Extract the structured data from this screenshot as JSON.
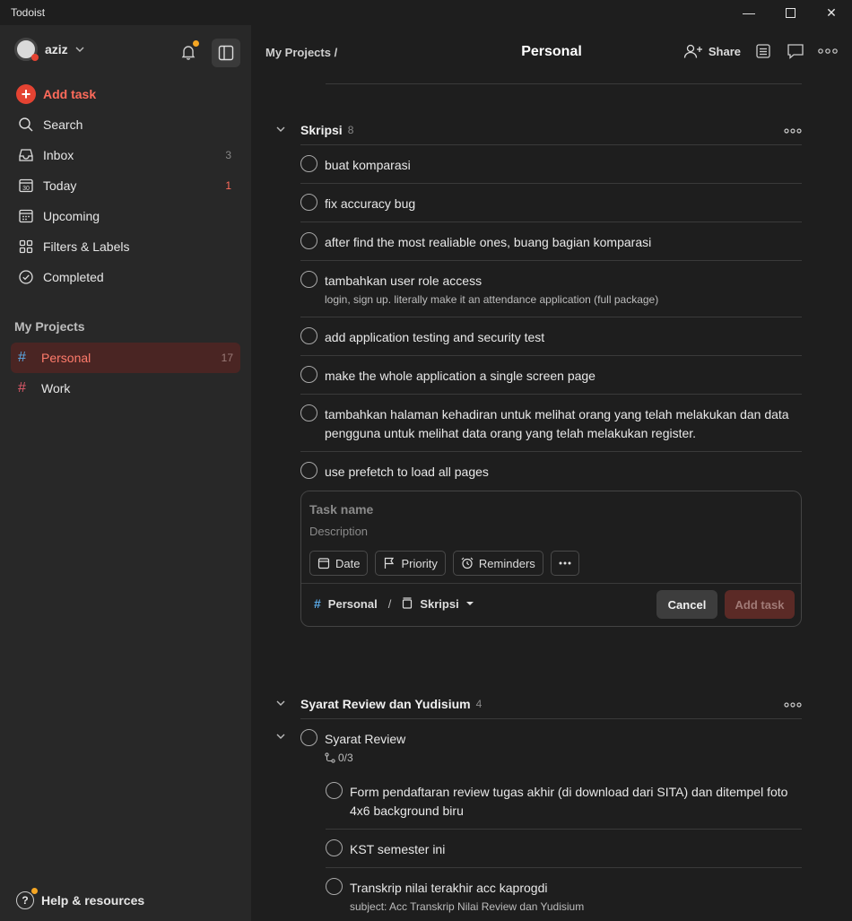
{
  "window": {
    "title": "Todoist",
    "minimize": "—",
    "maximize": "☐",
    "close": "✕"
  },
  "sidebar": {
    "user": "aziz",
    "add_task": "Add task",
    "nav": [
      {
        "label": "Search",
        "count": ""
      },
      {
        "label": "Inbox",
        "count": "3"
      },
      {
        "label": "Today",
        "count": "1"
      },
      {
        "label": "Upcoming",
        "count": ""
      },
      {
        "label": "Filters & Labels",
        "count": ""
      },
      {
        "label": "Completed",
        "count": ""
      }
    ],
    "today_day": "30",
    "projects_label": "My Projects",
    "projects": [
      {
        "label": "Personal",
        "count": "17"
      },
      {
        "label": "Work",
        "count": ""
      }
    ],
    "help": "Help & resources"
  },
  "header": {
    "breadcrumb": "My Projects /",
    "title": "Personal",
    "share": "Share"
  },
  "sections": [
    {
      "title": "Skripsi",
      "count": "8",
      "tasks": [
        {
          "name": "buat komparasi"
        },
        {
          "name": "fix accuracy bug"
        },
        {
          "name": "after find the most realiable ones, buang bagian komparasi"
        },
        {
          "name": "tambahkan user role access",
          "desc": "login, sign up. literally make it an attendance application (full package)"
        },
        {
          "name": "add application testing and security test"
        },
        {
          "name": "make the whole application a single screen page"
        },
        {
          "name": "tambahkan halaman kehadiran untuk melihat orang yang telah melakukan dan data pengguna untuk melihat data orang yang telah melakukan register."
        },
        {
          "name": "use prefetch to load all pages"
        }
      ]
    },
    {
      "title": "Syarat Review dan Yudisium",
      "count": "4",
      "tasks": [
        {
          "name": "Syarat Review",
          "subtasks": "0/3"
        },
        {
          "name": "Form pendaftaran review tugas akhir (di download dari SITA) dan ditempel foto 4x6 background biru"
        },
        {
          "name": "KST semester ini"
        },
        {
          "name": "Transkrip nilai terakhir acc kaprogdi",
          "desc": "subject: Acc Transkrip Nilai Review dan Yudisium"
        }
      ]
    }
  ],
  "editor": {
    "name_placeholder": "Task name",
    "desc_placeholder": "Description",
    "chips": [
      "Date",
      "Priority",
      "Reminders"
    ],
    "project": "Personal",
    "separator": "/",
    "section": "Skripsi",
    "cancel": "Cancel",
    "submit": "Add task"
  },
  "colors": {
    "accent": "#e44332",
    "active_project_bg": "#4a2523",
    "project_hash_blue": "#5aa9e6",
    "project_hash_red": "#e05a6a"
  },
  "icons": {
    "nav": [
      "search-icon",
      "inbox-icon",
      "calendar-today-icon",
      "calendar-upcoming-icon",
      "filters-icon",
      "check-circle-icon"
    ],
    "header": [
      "share-icon",
      "view-icon",
      "comments-icon",
      "more-icon"
    ]
  }
}
